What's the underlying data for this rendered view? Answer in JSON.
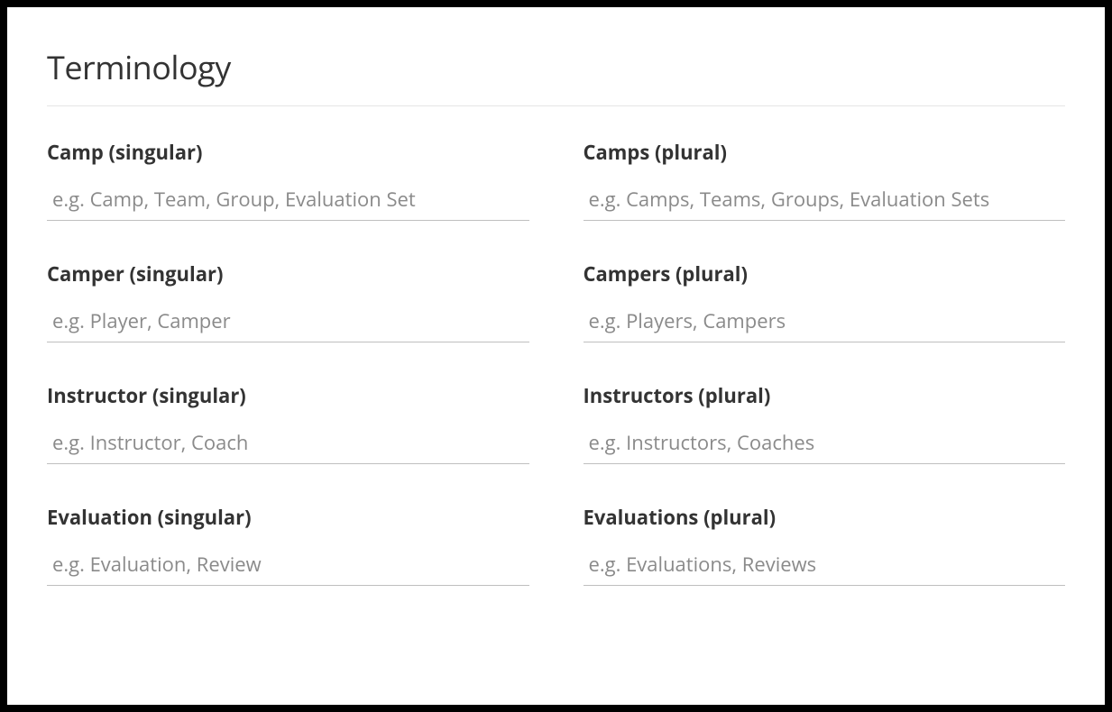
{
  "section": {
    "title": "Terminology"
  },
  "fields": {
    "camp_singular": {
      "label": "Camp (singular)",
      "placeholder": "e.g. Camp, Team, Group, Evaluation Set",
      "value": ""
    },
    "camps_plural": {
      "label": "Camps (plural)",
      "placeholder": "e.g. Camps, Teams, Groups, Evaluation Sets",
      "value": ""
    },
    "camper_singular": {
      "label": "Camper (singular)",
      "placeholder": "e.g. Player, Camper",
      "value": ""
    },
    "campers_plural": {
      "label": "Campers (plural)",
      "placeholder": "e.g. Players, Campers",
      "value": ""
    },
    "instructor_singular": {
      "label": "Instructor (singular)",
      "placeholder": "e.g. Instructor, Coach",
      "value": ""
    },
    "instructors_plural": {
      "label": "Instructors (plural)",
      "placeholder": "e.g. Instructors, Coaches",
      "value": ""
    },
    "evaluation_singular": {
      "label": "Evaluation (singular)",
      "placeholder": "e.g. Evaluation, Review",
      "value": ""
    },
    "evaluations_plural": {
      "label": "Evaluations (plural)",
      "placeholder": "e.g. Evaluations, Reviews",
      "value": ""
    }
  }
}
